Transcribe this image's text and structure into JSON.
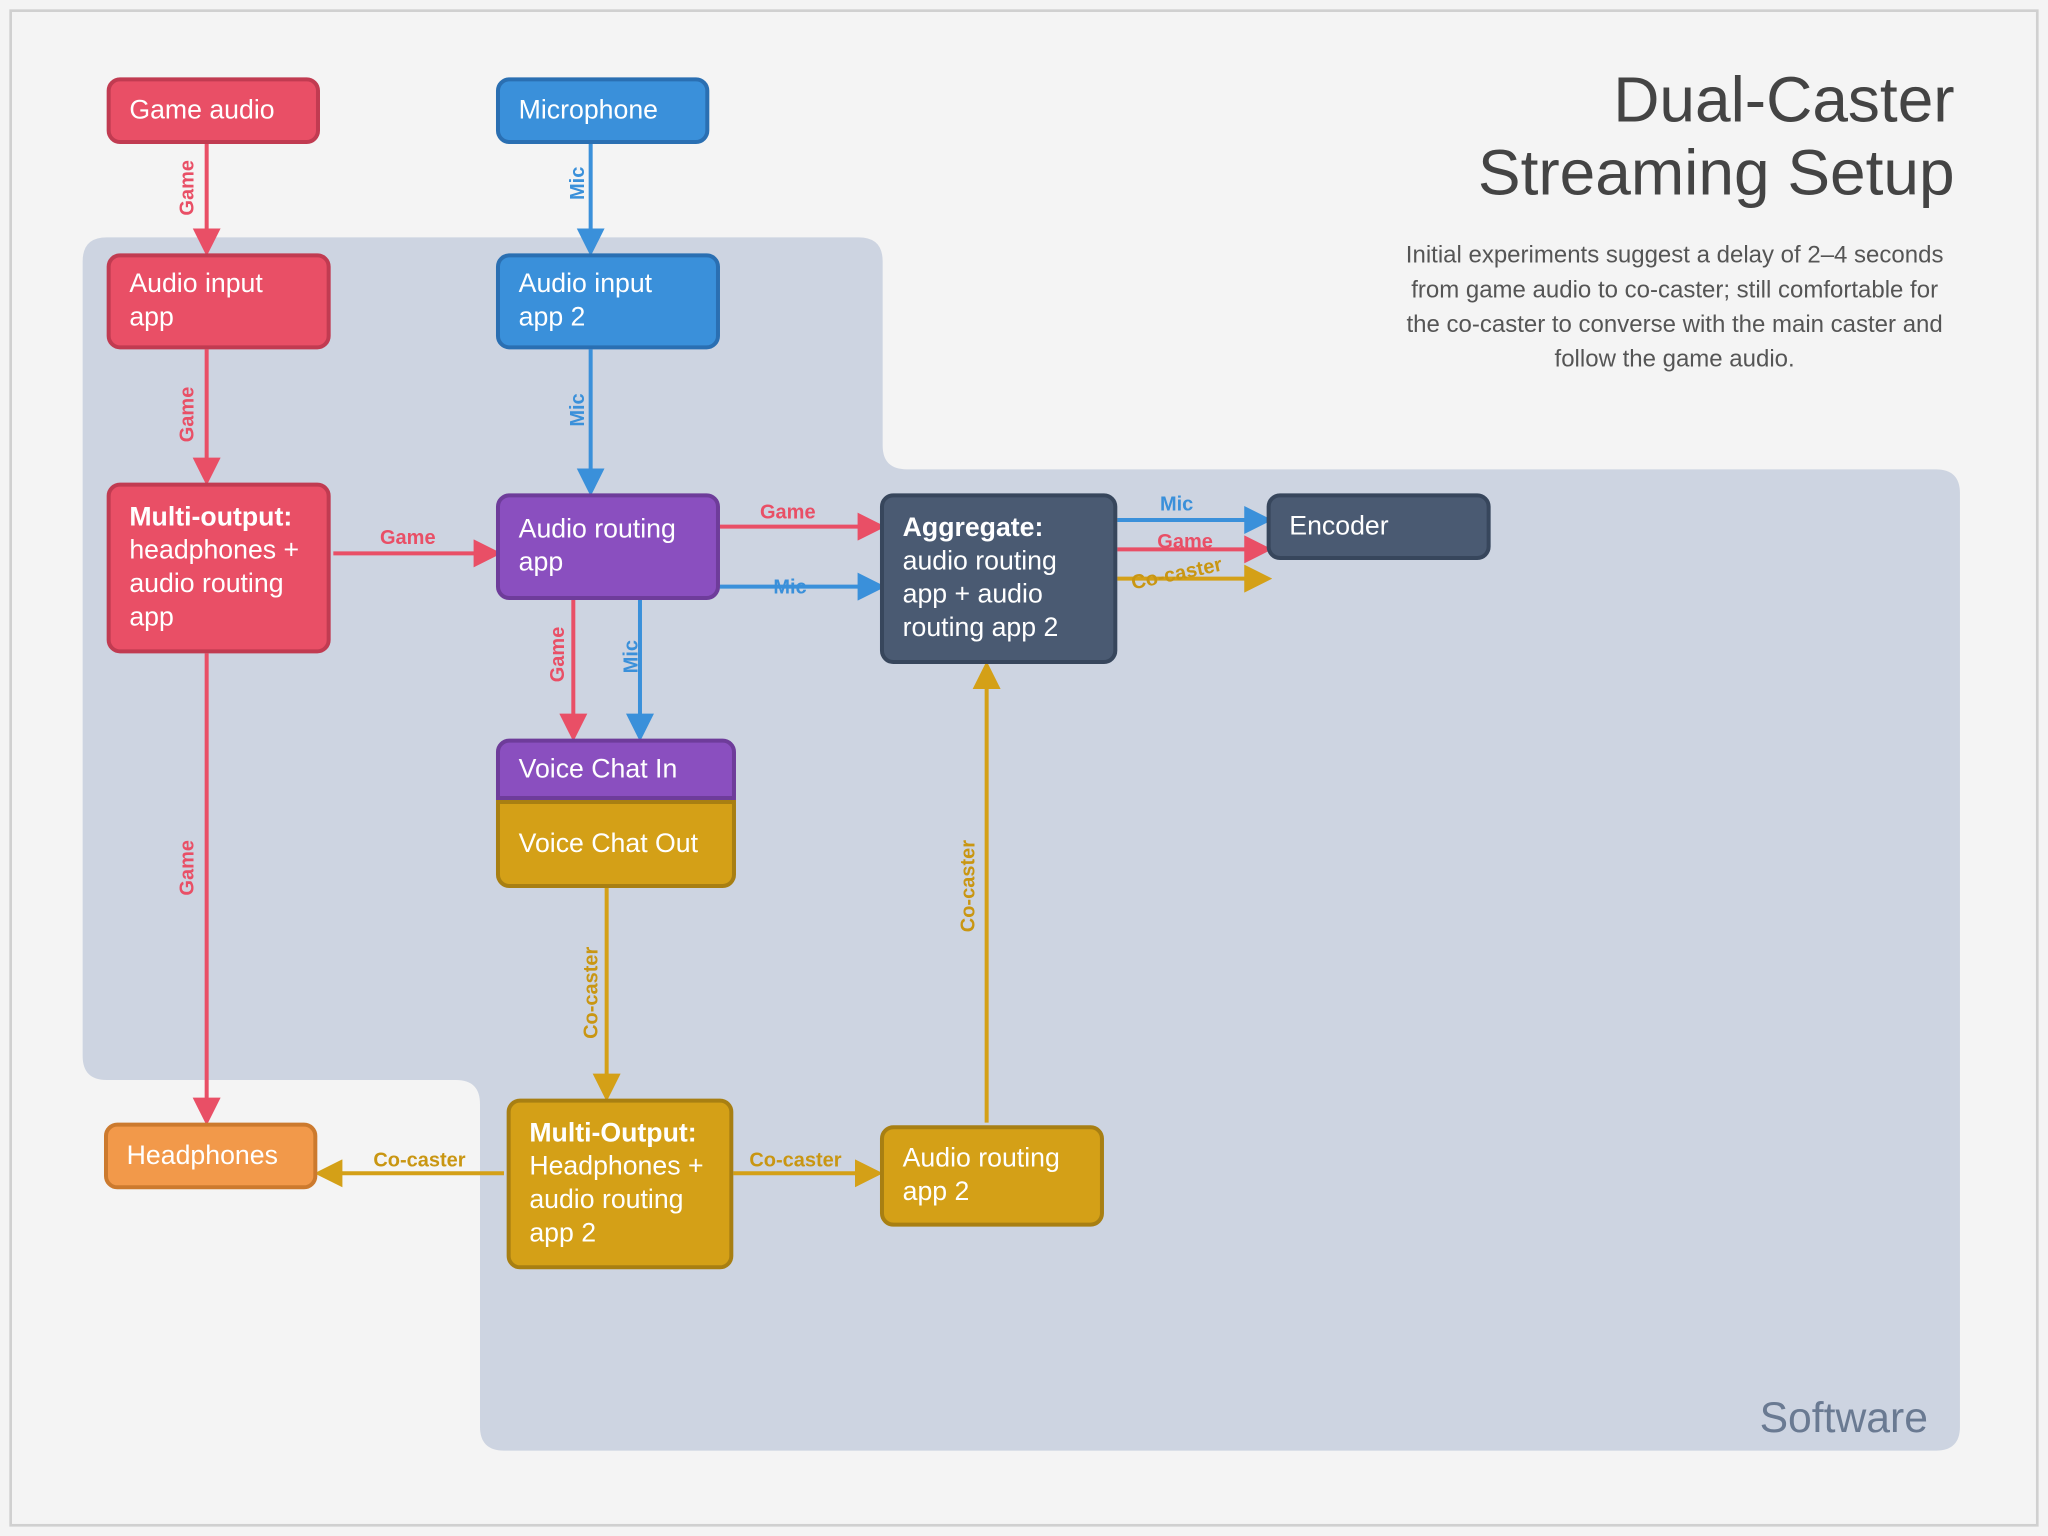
{
  "title_line1": "Dual-Caster",
  "title_line2": "Streaming Setup",
  "subtitle": "Initial experiments suggest a delay of 2–4 seconds from game audio to co-caster; still comfortable for the co-caster to converse with the main caster and follow the game audio.",
  "software_label": "Software",
  "nodes": {
    "game_audio": "Game audio",
    "microphone": "Microphone",
    "audio_input_1": "Audio input app",
    "audio_input_2": "Audio input app 2",
    "multi_output_1_bold": "Multi-output:",
    "multi_output_1_rest": "headphones + audio routing app",
    "audio_routing": "Audio routing app",
    "aggregate_bold": "Aggregate:",
    "aggregate_rest": "audio routing app + audio routing app 2",
    "encoder": "Encoder",
    "voice_chat_in": "Voice Chat In",
    "voice_chat_out": "Voice Chat Out",
    "multi_output_2_bold": "Multi-Output:",
    "multi_output_2_rest": "Headphones + audio routing app 2",
    "audio_routing_2": "Audio routing app 2",
    "headphones": "Headphones"
  },
  "labels": {
    "game": "Game",
    "mic": "Mic",
    "cocaster": "Co-caster"
  },
  "colors": {
    "red": "#e94f66",
    "blue": "#3a90da",
    "purple": "#8a4fbf",
    "gold": "#d4a017",
    "orange": "#f2994a",
    "slate": "#4a5a72",
    "software_fill": "#c5cedd"
  }
}
